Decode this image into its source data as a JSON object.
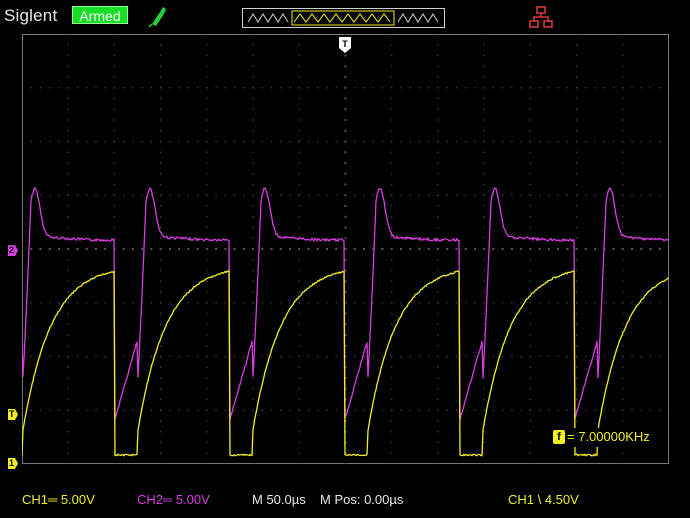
{
  "header": {
    "brand": "Siglent",
    "status": "Armed",
    "icons": [
      "probe-icon",
      "memory-depth-icon",
      "network-icon"
    ]
  },
  "markers": {
    "ch2": "2",
    "trigger_level": "T",
    "ch1": "1",
    "trigger_position": "T"
  },
  "measurement": {
    "icon": "f",
    "frequency": "= 7.00000KHz"
  },
  "footer": {
    "ch1_scale": "CH1═ 5.00V",
    "ch2_scale": "CH2═ 5.00V",
    "timebase": "M 50.0µs",
    "mpos": "M Pos: 0.00µs",
    "trigger": "CH1 \\ 4.50V"
  },
  "colors": {
    "ch1": "#f2ef22",
    "ch2": "#d63ee0",
    "grid": "#555555",
    "status_bg": "#16e026"
  },
  "settings": {
    "ch1_volts_per_div": 5.0,
    "ch2_volts_per_div": 5.0,
    "time_per_div_us": 50.0,
    "horizontal_divisions": 14,
    "vertical_divisions": 8,
    "frequency_khz": 7.0
  }
}
